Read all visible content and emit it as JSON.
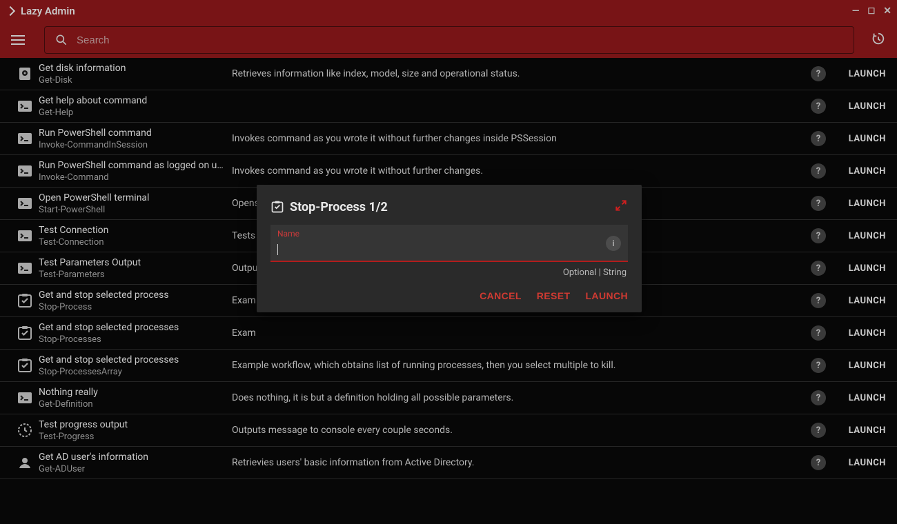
{
  "header": {
    "title": "Lazy Admin"
  },
  "search": {
    "placeholder": "Search",
    "value": ""
  },
  "rows": [
    {
      "icon": "disk",
      "title": "Get disk information",
      "sub": "Get-Disk",
      "desc": "Retrieves information like index, model, size and operational status."
    },
    {
      "icon": "shell",
      "title": "Get help about command",
      "sub": "Get-Help",
      "desc": ""
    },
    {
      "icon": "shell",
      "title": "Run PowerShell command",
      "sub": "Invoke-CommandInSession",
      "desc": "Invokes command as you wrote it without further changes inside PSSession"
    },
    {
      "icon": "shell",
      "title": "Run PowerShell command as logged on user",
      "sub": "Invoke-Command",
      "desc": "Invokes command as you wrote it without further changes."
    },
    {
      "icon": "shell",
      "title": "Open PowerShell terminal",
      "sub": "Start-PowerShell",
      "desc": "Opens"
    },
    {
      "icon": "shell",
      "title": "Test Connection",
      "sub": "Test-Connection",
      "desc": "Tests"
    },
    {
      "icon": "shell",
      "title": "Test Parameters Output",
      "sub": "Test-Parameters",
      "desc": "Outpu"
    },
    {
      "icon": "assign",
      "title": "Get and stop selected process",
      "sub": "Stop-Process",
      "desc": "Exam"
    },
    {
      "icon": "assign",
      "title": "Get and stop selected processes",
      "sub": "Stop-Processes",
      "desc": "Exam"
    },
    {
      "icon": "assign",
      "title": "Get and stop selected processes",
      "sub": "Stop-ProcessesArray",
      "desc": "Example workflow, which obtains list of running processes, then you select multiple to kill."
    },
    {
      "icon": "shell",
      "title": "Nothing really",
      "sub": "Get-Definition",
      "desc": "Does nothing, it is but a definition holding all possible parameters."
    },
    {
      "icon": "clock",
      "title": "Test progress output",
      "sub": "Test-Progress",
      "desc": "Outputs message to console every couple seconds."
    },
    {
      "icon": "user",
      "title": "Get AD user's information",
      "sub": "Get-ADUser",
      "desc": "Retrievies users' basic information from Active Directory."
    }
  ],
  "launch_label": "LAUNCH",
  "modal": {
    "title": "Stop-Process 1/2",
    "field_label": "Name",
    "field_value": "",
    "hint": "Optional | String",
    "cancel": "CANCEL",
    "reset": "RESET",
    "launch": "LAUNCH"
  }
}
